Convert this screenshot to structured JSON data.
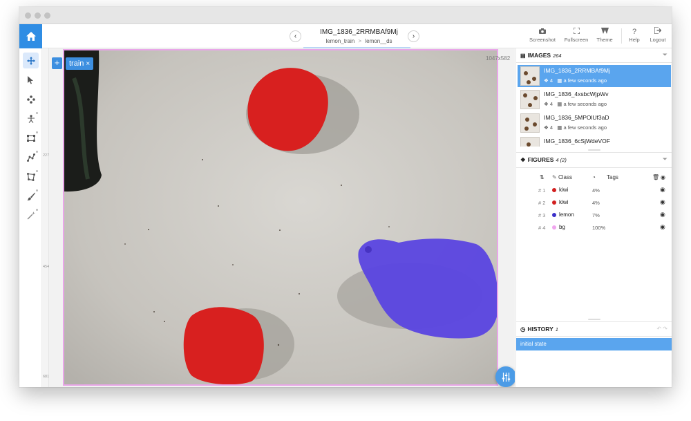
{
  "header": {
    "image_title": "IMG_1836_2RRMBAf9Mj",
    "breadcrumb_project": "lemon_train",
    "breadcrumb_separator": ">",
    "breadcrumb_dataset": "lemon__ds",
    "prev_icon": "chevron-left-icon",
    "next_icon": "chevron-right-icon"
  },
  "toolbar": {
    "screenshot_label": "Screenshot",
    "fullscreen_label": "Fullscreen",
    "theme_label": "Theme",
    "help_label": "Help",
    "logout_label": "Logout"
  },
  "left_tools": [
    "move-tool-icon",
    "select-tool-icon",
    "points-tool-icon",
    "keypoints-tool-icon",
    "rectangle-tool-icon",
    "polyline-tool-icon",
    "polygon-tool-icon",
    "brush-tool-icon",
    "smart-tool-icon"
  ],
  "canvas": {
    "tag_label": "train",
    "tag_close": "×",
    "add_label": "+",
    "image_size": "1047x582",
    "ruler_ticks": [
      "227",
      "454",
      "681"
    ]
  },
  "images_panel": {
    "title": "IMAGES",
    "count": "264",
    "items": [
      {
        "name": "IMG_1836_2RRMBAf9Mj",
        "figures": "4",
        "time": "a few seconds ago",
        "selected": true
      },
      {
        "name": "IMG_1836_4xsbcWjpWv",
        "figures": "4",
        "time": "a few seconds ago",
        "selected": false
      },
      {
        "name": "IMG_1836_5MPOlUf3aD",
        "figures": "4",
        "time": "a few seconds ago",
        "selected": false
      },
      {
        "name": "IMG_1836_6cSjWdeVOF",
        "figures": "",
        "time": "",
        "selected": false
      }
    ]
  },
  "figures_panel": {
    "title": "FIGURES",
    "count": "4 (2)",
    "col_class": "Class",
    "col_tags": "Tags",
    "rows": [
      {
        "num": "# 1",
        "class": "kiwi",
        "area": "4%",
        "color": "#d21f1f"
      },
      {
        "num": "# 2",
        "class": "kiwi",
        "area": "4%",
        "color": "#d21f1f"
      },
      {
        "num": "# 3",
        "class": "lemon",
        "area": "7%",
        "color": "#3b2fc9"
      },
      {
        "num": "# 4",
        "class": "bg",
        "area": "100%",
        "color": "#f0a6ee"
      }
    ]
  },
  "history_panel": {
    "title": "HISTORY",
    "count": "1",
    "items": [
      "initial state"
    ]
  },
  "colors": {
    "accent": "#2f8de4",
    "selection": "#5aa5ee",
    "kiwi": "#d21f1f",
    "lemon": "#3b2fc9",
    "bg": "#f0a6ee"
  }
}
